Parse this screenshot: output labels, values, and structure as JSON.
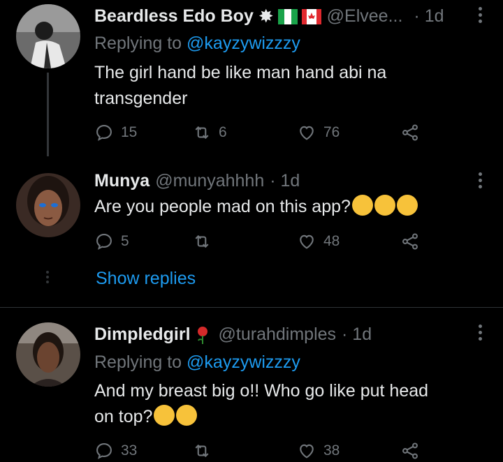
{
  "tweets": [
    {
      "name": "Beardless Edo Boy",
      "handle": "@Elvee...",
      "time": "· 1d",
      "replying_label": "Replying to ",
      "replying_handle": "@kayzywizzzy",
      "text_line1": "The girl hand be like man hand abi na",
      "text_line2": "transgender",
      "replies": "15",
      "retweets": "6",
      "likes": "76"
    },
    {
      "name": "Munya",
      "handle": "@munyahhhh",
      "time": "· 1d",
      "text_line1": "Are you people mad on this app?",
      "replies": "5",
      "retweets": "",
      "likes": "48",
      "show_replies": "Show replies"
    },
    {
      "name": "Dimpledgirl",
      "handle": "@turahdimples",
      "time": "· 1d",
      "replying_label": "Replying to ",
      "replying_handle": "@kayzywizzzy",
      "text_line1": "And my breast big o!! Who go like put head",
      "text_line2": "on top?",
      "replies": "33",
      "retweets": "",
      "likes": "38"
    }
  ],
  "colors": {
    "background": "#000000",
    "text": "#e7e9ea",
    "muted": "#71767b",
    "link": "#1d9bf0",
    "divider": "#2f3336"
  }
}
